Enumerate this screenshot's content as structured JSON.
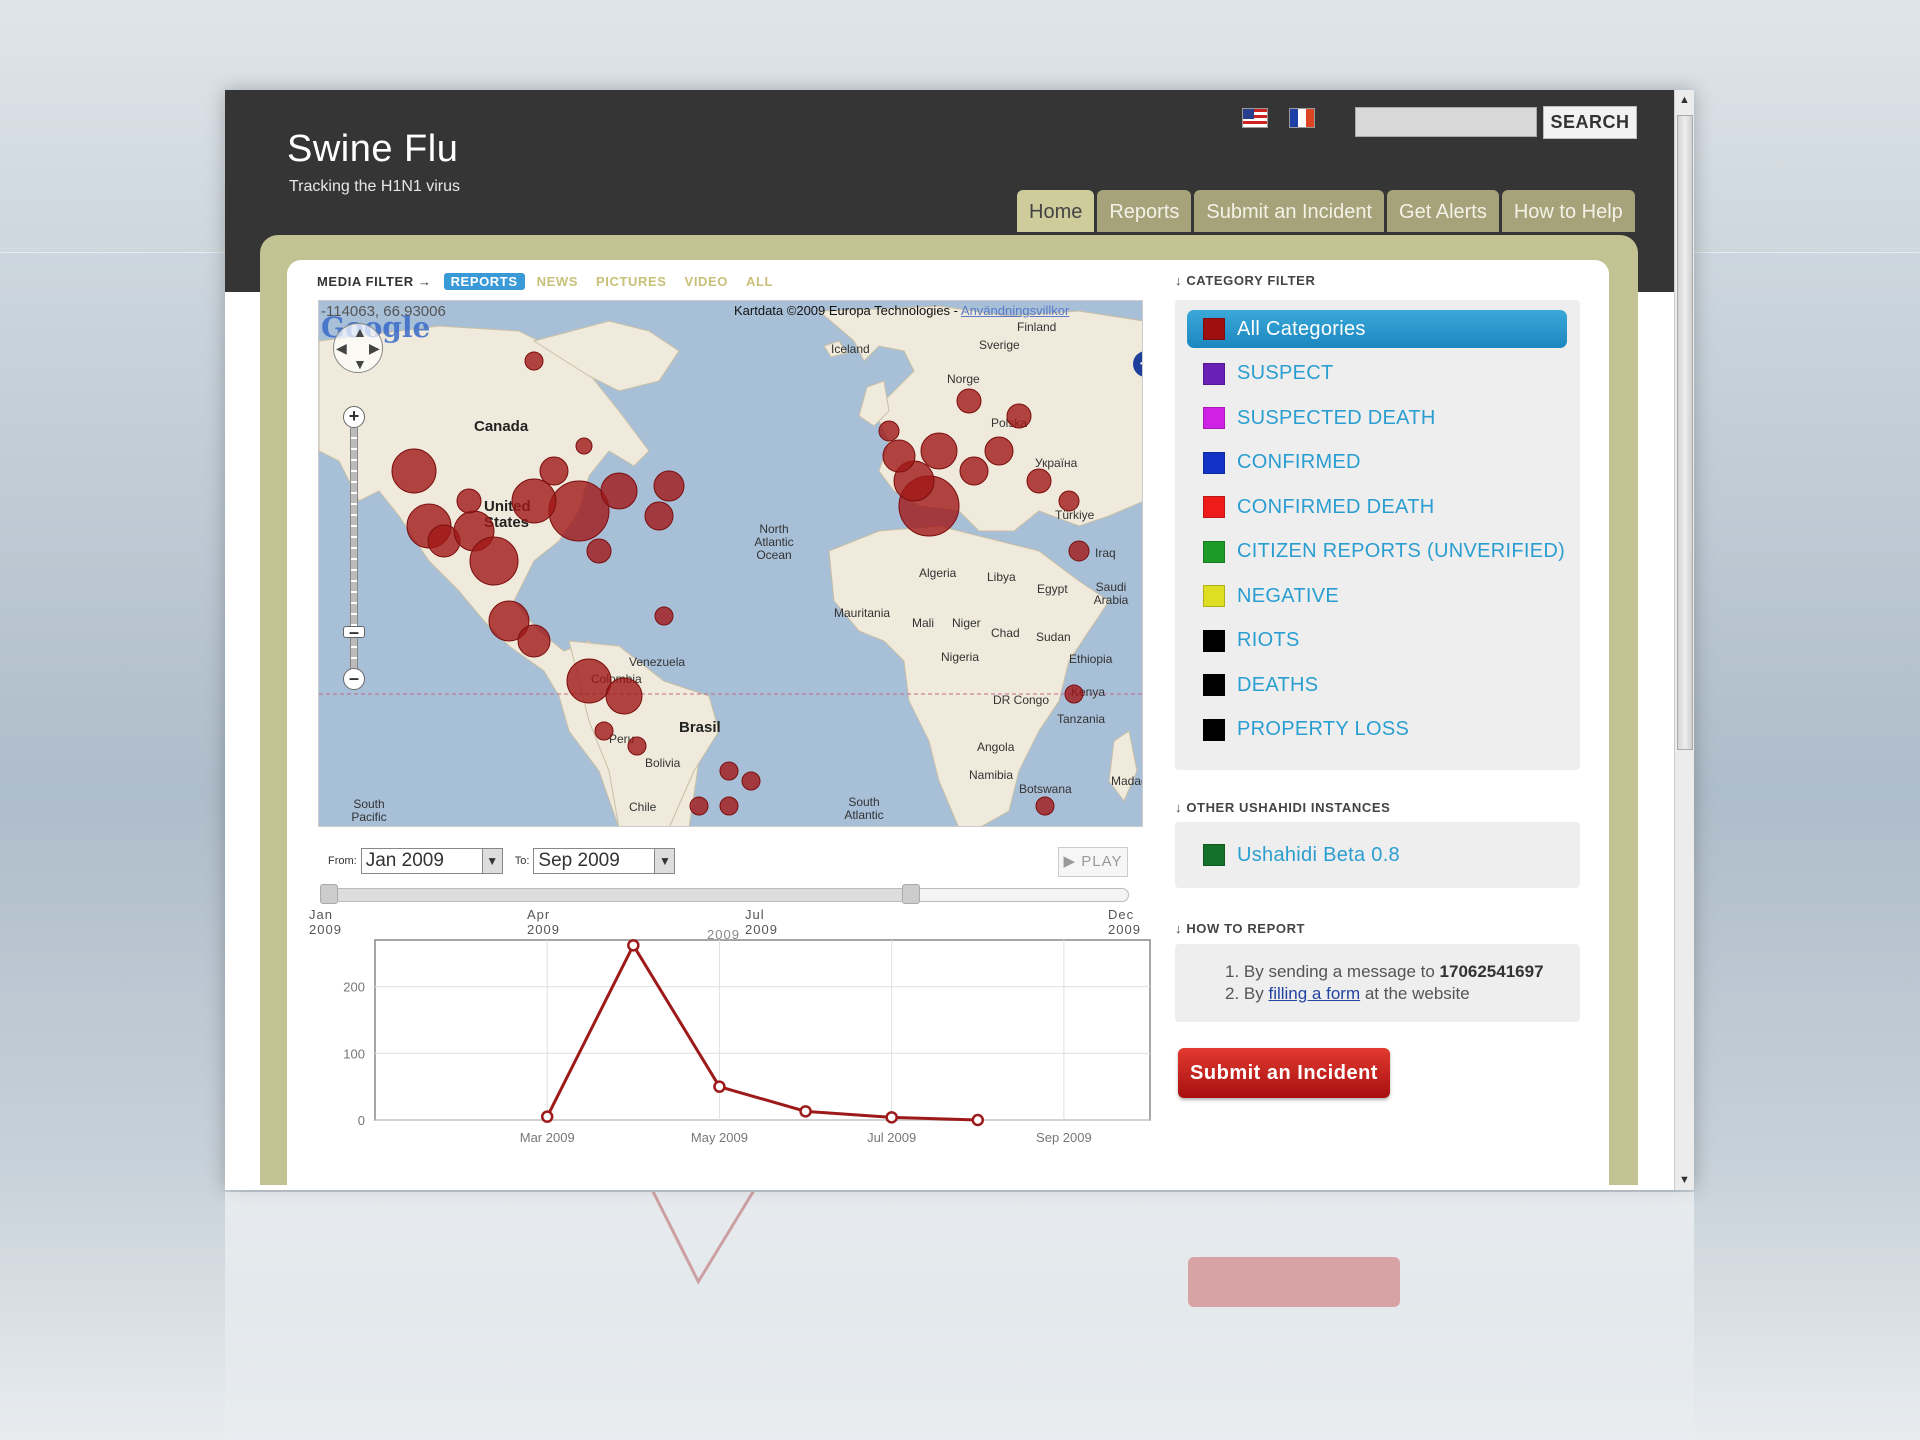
{
  "site": {
    "title": "Swine Flu",
    "tagline": "Tracking the H1N1 virus"
  },
  "languages": [
    {
      "name": "english-flag-icon"
    },
    {
      "name": "french-flag-icon"
    }
  ],
  "search": {
    "placeholder": "",
    "button": "SEARCH"
  },
  "nav": {
    "tabs": [
      "Home",
      "Reports",
      "Submit an Incident",
      "Get Alerts",
      "How to Help"
    ],
    "active": "Home"
  },
  "media_filter": {
    "title": "MEDIA FILTER →",
    "items": [
      "REPORTS",
      "NEWS",
      "PICTURES",
      "VIDEO",
      "ALL"
    ],
    "active": "REPORTS"
  },
  "map": {
    "coords": "-114063, 66.93006",
    "credit": "Kartdata ©2009 Europa Technologies -",
    "credit_link": "Användningsvillkor",
    "logo": "Google",
    "labels": {
      "canada": "Canada",
      "usa": "United States",
      "brasil": "Brasil",
      "north_atlantic": "North Atlantic Ocean",
      "south_atlantic": "South Atlantic",
      "south_pacific": "South Pacific",
      "iceland": "Iceland",
      "finland": "Finland",
      "sverige": "Sverige",
      "norge": "Norge",
      "polska": "Polska",
      "ukraine": "Україна",
      "turkiye": "Türkiye",
      "iraq": "Iraq",
      "algeria": "Algeria",
      "libya": "Libya",
      "egypt": "Egypt",
      "saudi": "Saudi Arabia",
      "mauritania": "Mauritania",
      "mali": "Mali",
      "niger": "Niger",
      "chad": "Chad",
      "sudan": "Sudan",
      "ethiopia": "Ethiopia",
      "nigeria": "Nigeria",
      "dr_congo": "DR Congo",
      "kenya": "Kenya",
      "tanzania": "Tanzania",
      "angola": "Angola",
      "namibia": "Namibia",
      "botswana": "Botswana",
      "bolivia": "Bolivia",
      "venezuela": "Venezuela",
      "colombia": "Colombia",
      "peru": "Peru",
      "chile": "Chile",
      "madagascar": "Madagas"
    },
    "marker_color": "#a01818"
  },
  "timeline": {
    "from_label": "From:",
    "from_value": "Jan 2009",
    "to_label": "To:",
    "to_value": "Sep 2009",
    "play": "PLAY",
    "ticks": [
      {
        "month": "Jan",
        "year": "2009"
      },
      {
        "month": "Apr",
        "year": "2009"
      },
      {
        "month": "Jul",
        "year": "2009"
      },
      {
        "month": "Dec",
        "year": "2009"
      }
    ],
    "extra_year": "2009",
    "selected_fraction": 0.73
  },
  "chart_data": {
    "type": "line",
    "x": [
      "Mar 2009",
      "Apr 2009",
      "May 2009",
      "Jun 2009",
      "Jul 2009",
      "Aug 2009"
    ],
    "values": [
      5,
      262,
      50,
      13,
      4,
      0
    ],
    "x_ticks": [
      "Mar 2009",
      "May 2009",
      "Jul 2009",
      "Sep 2009"
    ],
    "y_ticks": [
      0,
      100,
      200
    ],
    "ylim": [
      0,
      270
    ],
    "xlim": [
      "Jan 2009",
      "Oct 2009"
    ],
    "grid": true,
    "color": "#9e1a1a"
  },
  "category_filter": {
    "title": "CATEGORY FILTER",
    "items": [
      {
        "label": "All Categories",
        "color": "#9e0f0f",
        "active": true
      },
      {
        "label": "SUSPECT",
        "color": "#6a1fb6"
      },
      {
        "label": "SUSPECTED DEATH",
        "color": "#d022e6"
      },
      {
        "label": "CONFIRMED",
        "color": "#1532c6"
      },
      {
        "label": "CONFIRMED DEATH",
        "color": "#ee1b1b"
      },
      {
        "label": "CITIZEN REPORTS (UNVERIFIED)",
        "color": "#1c9a2a"
      },
      {
        "label": "NEGATIVE",
        "color": "#dede22"
      },
      {
        "label": "RIOTS",
        "color": "#000000"
      },
      {
        "label": "DEATHS",
        "color": "#000000"
      },
      {
        "label": "PROPERTY LOSS",
        "color": "#000000"
      }
    ]
  },
  "other_instances": {
    "title": "OTHER USHAHIDI INSTANCES",
    "items": [
      {
        "label": "Ushahidi Beta 0.8",
        "color": "#15702a"
      }
    ]
  },
  "how_to_report": {
    "title": "HOW TO REPORT",
    "item1_prefix": "1.  By sending a message to ",
    "item1_number": "17062541697",
    "item2_prefix": "2.  By ",
    "item2_link": "filling a form",
    "item2_suffix": " at the website"
  },
  "submit_button": "Submit an Incident"
}
